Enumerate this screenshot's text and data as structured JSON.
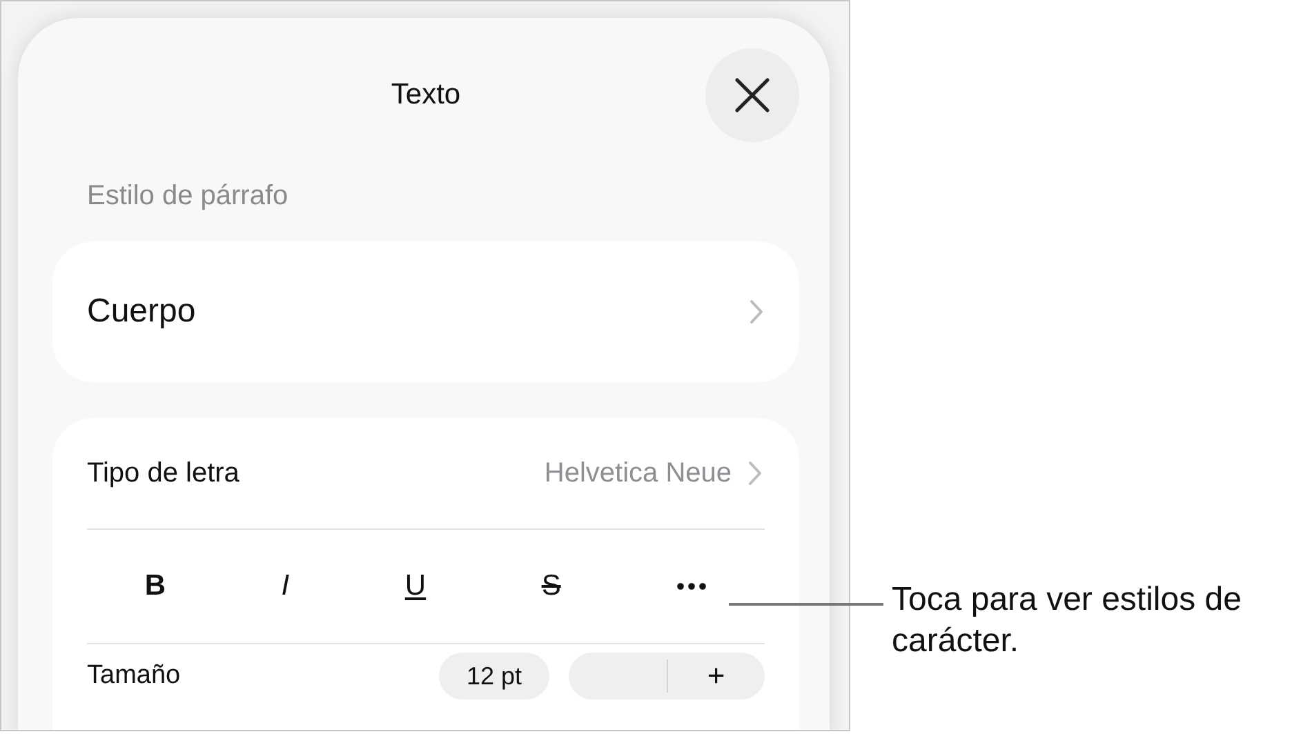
{
  "title": "Texto",
  "paragraph_style": {
    "heading": "Estilo de párrafo",
    "value": "Cuerpo"
  },
  "font": {
    "label": "Tipo de letra",
    "value": "Helvetica Neue"
  },
  "format_buttons": [
    {
      "kind": "bold",
      "label": "B"
    },
    {
      "kind": "italic",
      "label": "I"
    },
    {
      "kind": "underline",
      "label": "U"
    },
    {
      "kind": "strike",
      "label": "S"
    },
    {
      "kind": "more"
    }
  ],
  "size": {
    "label": "Tamaño",
    "value": "12 pt",
    "increment": "+"
  },
  "callout": "Toca para ver estilos de carácter."
}
